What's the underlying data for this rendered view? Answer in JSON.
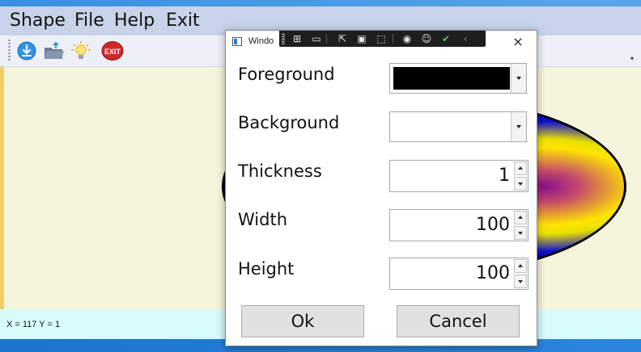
{
  "menu": {
    "items": [
      "Shape",
      "File",
      "Help",
      "Exit"
    ]
  },
  "toolbar": {
    "buttons": [
      {
        "icon": "download-icon",
        "color": "#2f93e6"
      },
      {
        "icon": "open-folder-icon",
        "color": "#5a6b7e"
      },
      {
        "icon": "lightbulb-icon",
        "color": "#f4d43c"
      },
      {
        "icon": "exit-icon",
        "label": "EXIT",
        "color": "#d3282a"
      }
    ]
  },
  "status": {
    "text": "X = 117 Y = 1"
  },
  "dialog": {
    "title": "Windo",
    "close_glyph": "×",
    "fields": {
      "foreground": {
        "label": "Foreground",
        "color": "#000000"
      },
      "background": {
        "label": "Background",
        "color": "#ffffff"
      },
      "thickness": {
        "label": "Thickness",
        "value": "1"
      },
      "width": {
        "label": "Width",
        "value": "100"
      },
      "height": {
        "label": "Height",
        "value": "100"
      }
    },
    "ok_label": "Ok",
    "cancel_label": "Cancel"
  },
  "colors": {
    "menubar": "#c8d3e9",
    "canvas": "#f5f4dc",
    "statusbar": "#d8fbfb"
  }
}
